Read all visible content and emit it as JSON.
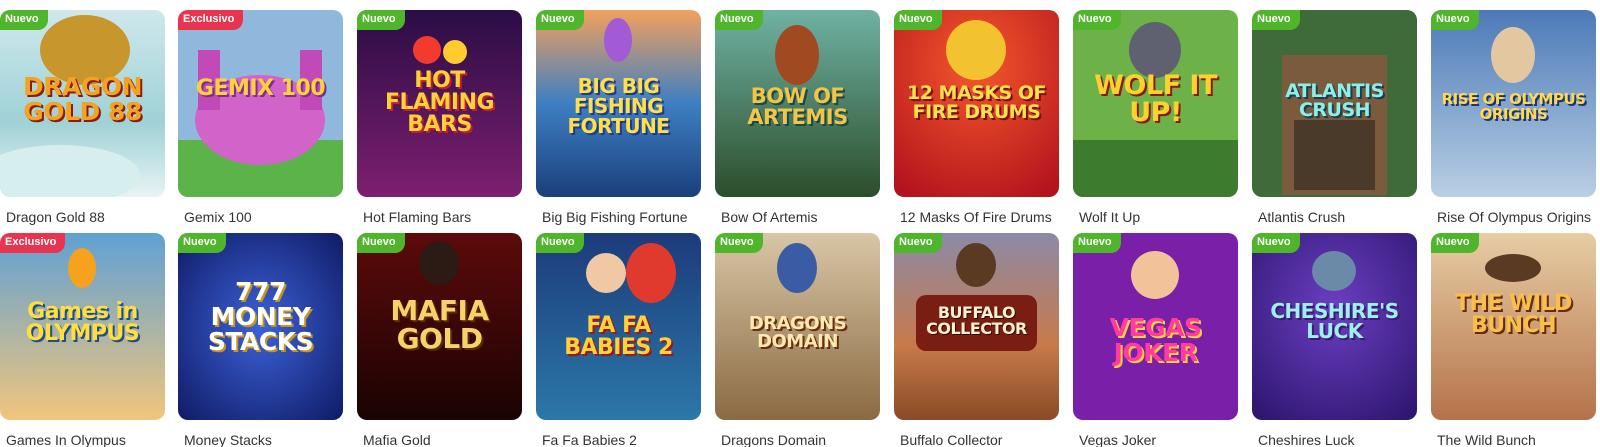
{
  "badges": {
    "nuevo": "Nuevo",
    "exclusivo": "Exclusivo"
  },
  "games": [
    {
      "title": "Dragon Gold 88",
      "badge": "exclusivo_hidden",
      "badge_label": "Nuevo",
      "logo": "DRAGON GOLD 88",
      "icon": "dragon-icon"
    },
    {
      "title": "Gemix 100",
      "badge_label": "Exclusivo",
      "logo": "GEMIX 100",
      "icon": "wizard-icon"
    },
    {
      "title": "Hot Flaming Bars",
      "badge_label": "Nuevo",
      "logo": "HOT FLAMING BARS",
      "icon": "fruit-icon"
    },
    {
      "title": "Big Big Fishing Fortune",
      "badge_label": "Nuevo",
      "logo": "BIG BIG FISHING FORTUNE",
      "icon": "fish-icon"
    },
    {
      "title": "Bow Of Artemis",
      "badge_label": "Nuevo",
      "logo": "BOW OF ARTEMIS",
      "icon": "deer-icon"
    },
    {
      "title": "12 Masks Of Fire Drums",
      "badge_label": "Nuevo",
      "logo": "12 MASKS OF FIRE DRUMS",
      "icon": "mask-icon"
    },
    {
      "title": "Wolf It Up",
      "badge_label": "Nuevo",
      "logo": "WOLF IT UP!",
      "icon": "wolf-icon"
    },
    {
      "title": "Atlantis Crush",
      "badge_label": "Nuevo",
      "logo": "ATLANTIS CRUSH",
      "icon": "temple-icon"
    },
    {
      "title": "Rise Of Olympus Origins",
      "badge_label": "Nuevo",
      "logo": "RISE OF OLYMPUS ORIGINS",
      "icon": "zeus-icon"
    },
    {
      "title": "Games In Olympus",
      "badge_label": "Exclusivo",
      "logo": "Games in OLYMPUS",
      "icon": "torch-icon"
    },
    {
      "title": "Money Stacks",
      "badge_label": "Nuevo",
      "logo": "777 MONEY STACKS",
      "icon": "seven-icon"
    },
    {
      "title": "Mafia Gold",
      "badge_label": "Nuevo",
      "logo": "MAFIA GOLD",
      "icon": "mafioso-icon"
    },
    {
      "title": "Fa Fa Babies 2",
      "badge_label": "Nuevo",
      "logo": "FA FA BABIES 2",
      "icon": "baby-icon"
    },
    {
      "title": "Dragons Domain",
      "badge_label": "Nuevo",
      "logo": "DRAGONS DOMAIN",
      "icon": "knight-icon"
    },
    {
      "title": "Buffalo Collector",
      "badge_label": "Nuevo",
      "logo": "BUFFALO COLLECTOR",
      "icon": "buffalo-icon"
    },
    {
      "title": "Vegas Joker",
      "badge_label": "Nuevo",
      "logo": "VEGAS JOKER",
      "icon": "joker-icon"
    },
    {
      "title": "Cheshires Luck",
      "badge_label": "Nuevo",
      "logo": "CHESHIRE'S LUCK",
      "icon": "cat-icon"
    },
    {
      "title": "The Wild Bunch",
      "badge_label": "Nuevo",
      "logo": "THE WILD BUNCH",
      "icon": "cowboy-icon"
    }
  ]
}
